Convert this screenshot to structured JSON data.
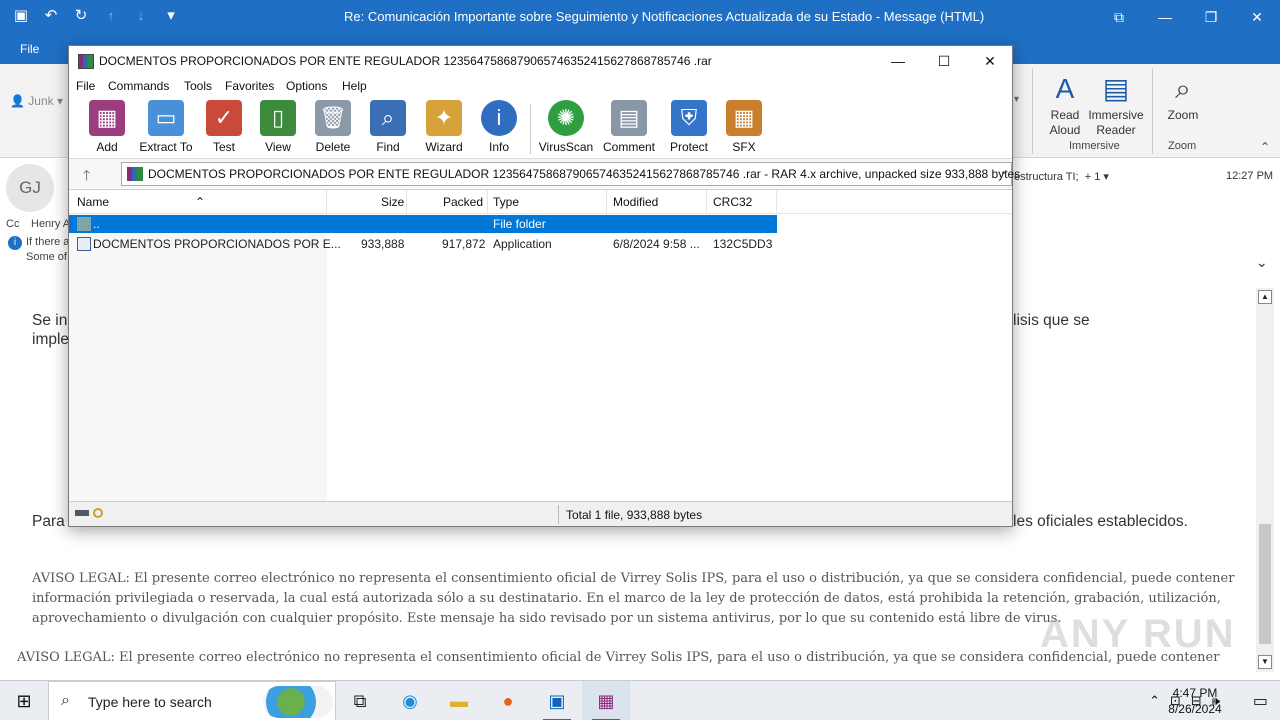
{
  "outlook": {
    "title": "Re: Comunicación Importante sobre Seguimiento y Notificaciones Actualizada de su Estado  -  Message (HTML)",
    "file_tab": "File",
    "junk": "Junk",
    "ribbon": {
      "read_aloud": "Read Aloud",
      "immersive_reader": "Immersive Reader",
      "immersive_caption": "Immersive",
      "zoom": "Zoom",
      "zoom_caption": "Zoom"
    },
    "header": {
      "avatar_initials": "GJ",
      "cc_label": "Cc",
      "cc_name": "Henry A",
      "info_line1": "If there a",
      "info_line2": "Some of",
      "to_snippet": "estructura TI;",
      "more_count": "+ 1",
      "time": "12:27 PM"
    },
    "body": {
      "line1_start": "Se in",
      "line1_end": "lisis que se",
      "line2_start": "imple",
      "para_start": "Para",
      "para_end": "les oficiales establecidos.",
      "legal1": "AVISO LEGAL: El presente correo electrónico no representa el consentimiento oficial de Virrey Solis IPS, para el uso o distribución, ya que se considera confidencial, puede contener información privilegiada o reservada, la cual está autorizada sólo a su destinatario. En el marco de la ley de protección de datos, está prohibida la retención, grabación, utilización, aprovechamiento o divulgación con cualquier propósito. Este mensaje ha sido revisado por un sistema antivirus, por lo que su contenido está libre de virus.",
      "legal2": "AVISO LEGAL: El presente correo electrónico no representa el consentimiento oficial de Virrey Solis IPS, para el uso o distribución, ya que se considera confidencial, puede contener"
    },
    "watermark": "ANY RUN"
  },
  "winrar": {
    "title": "DOCMENTOS PROPORCIONADOS POR ENTE REGULADOR 1235647586879065746352415627868785746 .rar",
    "menu": [
      "File",
      "Commands",
      "Tools",
      "Favorites",
      "Options",
      "Help"
    ],
    "toolbar": [
      "Add",
      "Extract To",
      "Test",
      "View",
      "Delete",
      "Find",
      "Wizard",
      "Info",
      "VirusScan",
      "Comment",
      "Protect",
      "SFX"
    ],
    "path": "DOCMENTOS PROPORCIONADOS POR ENTE REGULADOR 1235647586879065746352415627868785746 .rar - RAR 4.x archive, unpacked size 933,888 bytes",
    "columns": [
      "Name",
      "Size",
      "Packed",
      "Type",
      "Modified",
      "CRC32"
    ],
    "rows": [
      {
        "name": "..",
        "size": "",
        "packed": "",
        "type": "File folder",
        "modified": "",
        "crc": ""
      },
      {
        "name": "DOCMENTOS PROPORCIONADOS POR E...",
        "size": "933,888",
        "packed": "917,872",
        "type": "Application",
        "modified": "6/8/2024 9:58 ...",
        "crc": "132C5DD3"
      }
    ],
    "status": "Total 1 file, 933,888 bytes"
  },
  "taskbar": {
    "search_placeholder": "Type here to search",
    "time": "4:47 PM",
    "date": "8/26/2024"
  },
  "colors": {
    "outlook_blue": "#1f6fc4",
    "selection_blue": "#0078d7"
  }
}
